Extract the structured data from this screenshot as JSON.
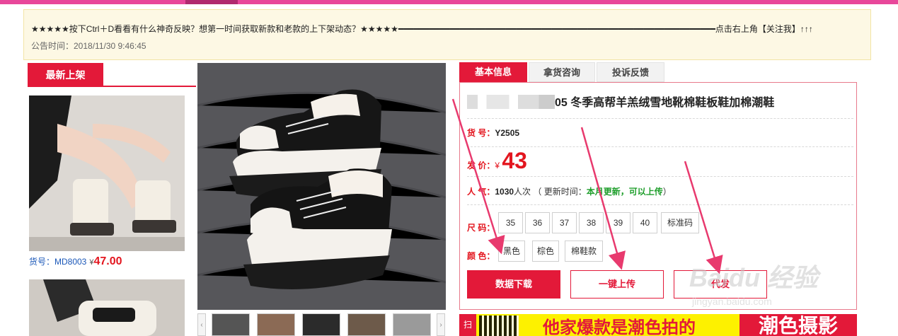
{
  "notice": {
    "text": "★★★★★按下Ctrl＋D看看有什么神奇反映？想第一时间获取新款和老款的上下架动态？★★★★★━━━━━━━━━━━━━━━━━━━━━━━━━━━━━━━━━━━━━━━━━━━━━━━━━━━━━━━━━━━━━━点击右上角【关注我】↑↑↑",
    "time": "公告时间：2018/11/30 9:46:45"
  },
  "left": {
    "tab_label": "最新上架",
    "items": [
      {
        "code": "货号：MD8003",
        "yen": "¥",
        "price": "47.00"
      }
    ]
  },
  "product": {
    "tabs": [
      "基本信息",
      "拿货咨询",
      "投诉反馈"
    ],
    "title": "05 冬季高帮羊羔绒雪地靴棉鞋板鞋加棉潮鞋",
    "sku_label": "货 号：",
    "sku": "Y2505",
    "price_label": "发 价：",
    "price_yen": "¥",
    "price": "43",
    "pop_label": "人 气：",
    "pop_count": "1030",
    "pop_unit": "人次",
    "update_prefix": "（ 更新时间：",
    "update_text": "本月更新，可以上传",
    "update_suffix": "）",
    "size_label": "尺 码：",
    "sizes": [
      "35",
      "36",
      "37",
      "38",
      "39",
      "40",
      "标准码"
    ],
    "color_label": "颜 色：",
    "colors": [
      "黑色",
      "棕色",
      "棉鞋款"
    ],
    "buttons": {
      "download": "数据下载",
      "upload": "一键上传",
      "dropship": "代发"
    }
  },
  "banner": {
    "scan": "扫",
    "slogan": "他家爆款是潮色拍的",
    "studio": "潮色摄影"
  },
  "watermark": {
    "brand": "Baidu 经验",
    "url": "jingyan.baidu.com"
  },
  "colors": {
    "accent": "#e31939",
    "topbar": "#e8479a",
    "notice_bg": "#fdf8e4",
    "banner_bg": "#fdf100",
    "price": "#e3161f",
    "green": "#1e9e2b"
  }
}
